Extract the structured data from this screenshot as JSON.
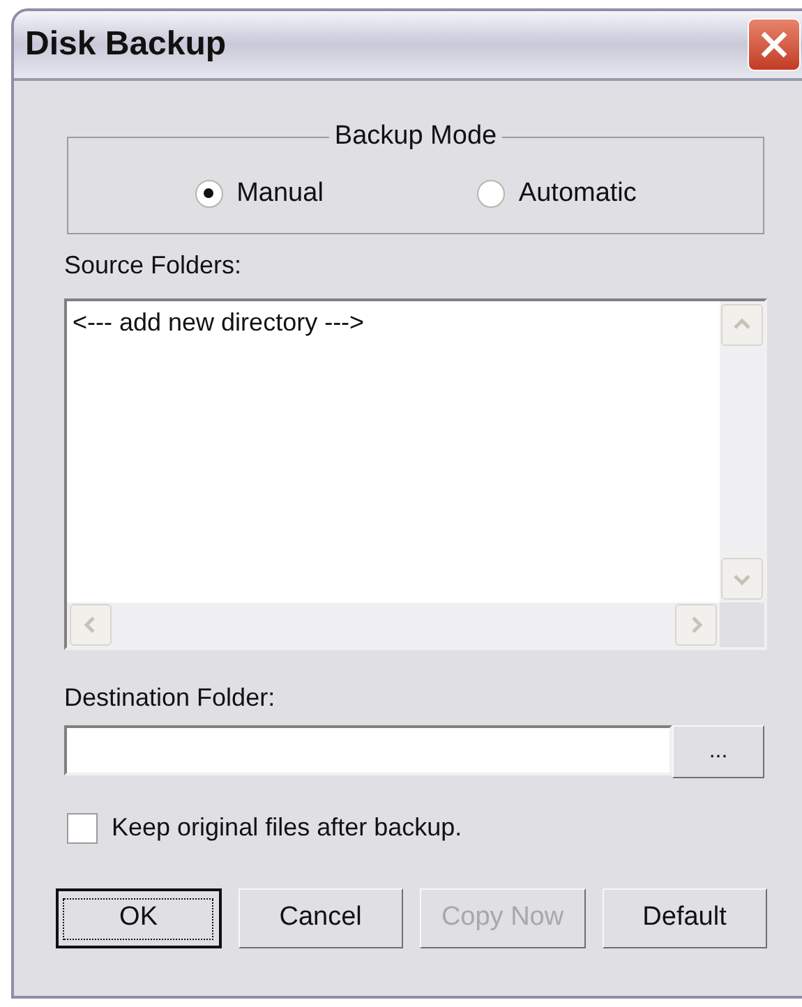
{
  "window": {
    "title": "Disk Backup"
  },
  "backup_mode": {
    "label": "Backup Mode",
    "options": [
      {
        "label": "Manual",
        "selected": true
      },
      {
        "label": "Automatic",
        "selected": false
      }
    ]
  },
  "source_folders": {
    "label": "Source Folders:",
    "items": [
      "<--- add new directory --->"
    ]
  },
  "destination": {
    "label": "Destination Folder:",
    "browse_button": "..."
  },
  "keep_original": {
    "label": "Keep original files after backup.",
    "checked": false
  },
  "buttons": [
    {
      "label": "OK",
      "focused": true,
      "disabled": false
    },
    {
      "label": "Cancel",
      "focused": false,
      "disabled": false
    },
    {
      "label": "Copy Now",
      "focused": false,
      "disabled": true
    },
    {
      "label": "Default",
      "focused": false,
      "disabled": false
    }
  ]
}
